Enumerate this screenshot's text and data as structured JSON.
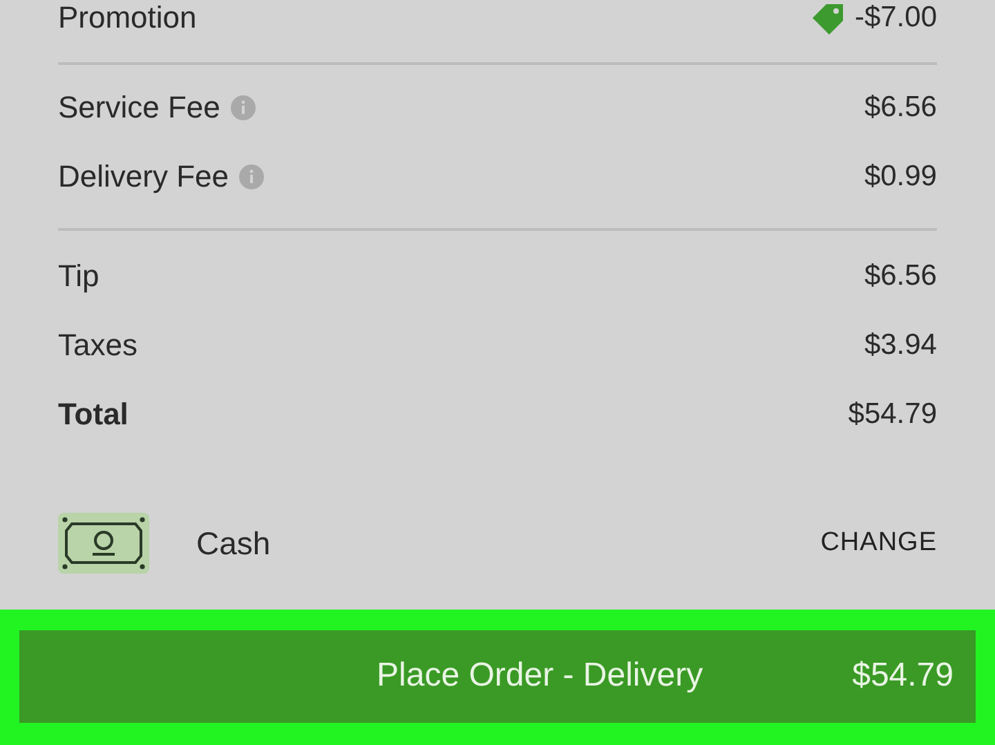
{
  "sections": [
    [
      {
        "kind": "promo",
        "label": "Promotion",
        "amount": "-$7.00"
      }
    ],
    [
      {
        "kind": "info",
        "label": "Service Fee",
        "amount": "$6.56"
      },
      {
        "kind": "info",
        "label": "Delivery Fee",
        "amount": "$0.99"
      }
    ],
    [
      {
        "kind": "plain",
        "label": "Tip",
        "amount": "$6.56"
      },
      {
        "kind": "plain",
        "label": "Taxes",
        "amount": "$3.94"
      },
      {
        "kind": "total",
        "label": "Total",
        "amount": "$54.79"
      }
    ]
  ],
  "payment": {
    "method": "Cash",
    "action": "CHANGE"
  },
  "place_order": {
    "label": "Place Order - Delivery",
    "amount": "$54.79",
    "highlighted": true
  }
}
